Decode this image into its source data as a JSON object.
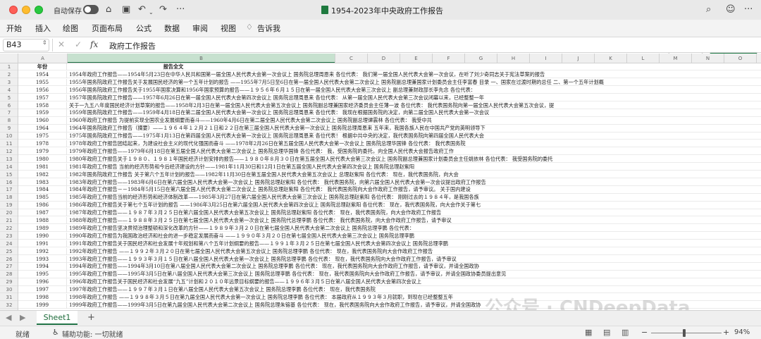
{
  "titlebar": {
    "autosave_label": "自动保存",
    "doc_title": "1954-2023年中央政府工作报告"
  },
  "ribbon": {
    "tabs": [
      "开始",
      "插入",
      "绘图",
      "页面布局",
      "公式",
      "数据",
      "审阅",
      "视图",
      "告诉我"
    ],
    "comment_label": "批注",
    "share_label": "共享"
  },
  "formula_bar": {
    "name_box": "B43",
    "fx_label": "fx",
    "content": "政府工作报告"
  },
  "sheet": {
    "selected_column": "B",
    "column_headers": [
      "A",
      "B",
      "C",
      "D",
      "E",
      "F",
      "G",
      "H",
      "I",
      "J",
      "K",
      "L",
      "M",
      "N",
      "O",
      "P",
      "Q",
      "R",
      "S",
      "T",
      "U"
    ],
    "header_row": {
      "year": "年份",
      "content": "报告全文"
    },
    "rows": [
      {
        "n": "1",
        "a": "年份",
        "b": "报告全文"
      },
      {
        "n": "2",
        "a": "1954",
        "b": "1954年政府工作报告——1954年5月23日在中华人民共和国第一届全国人民代表大会第一次会议上                                    国务院总理周恩来        各位代表：        我们第一届全国人民代表大会第一次会议，在听了刘少奇同志关于宪法草案的报告"
      },
      {
        "n": "3",
        "a": "1955",
        "b": "1955年国务院政府工作报告关于发展国民经济的第一个五年计划的报告 ——1955年7月5日至6日在第一届全国人民代表大会第二次会议上                      国务院副总理兼国家计划委员会主任李富春  目录    一、国家在过渡时期的总任    二、第一个五年计划概"
      },
      {
        "n": "4",
        "a": "1956",
        "b": "1956年国务院政府工作报告关于1955年国家决算和1956年国家预算的报告——１９５６年６月１５日在第一届全国人民代表大会第三次会议上                                              副总理兼财政部长李先念        各位代表："
      },
      {
        "n": "5",
        "a": "1957",
        "b": "1957年国务院政府工作报告——1957年6月26日在第一届全国人民代表大会第四次会议上                          国务院总理周恩来        各位代表：        从第一届全国人民代表大会第三次会议闭幕以来，已经整整一年"
      },
      {
        "n": "6",
        "a": "1958",
        "b": "关于一九五八年度国民经济计划草案的报告——1958年2月3日在第一届全国人民代表大会第五次会议上          国务院副总理兼国家经济委员会主任薄一波        各位代表：        我代表国务院向第一届全国人民代表大会第五次会议，提"
      },
      {
        "n": "7",
        "a": "1959",
        "b": "1959年国务院政府工作报告——1959年4月18日在第二届全国人民代表大会第一次会议上                          国务院总理周恩来        各位代表：        我现在根据国务院的决定，向第二届全国人民代表大会第一次会议"
      },
      {
        "n": "8",
        "a": "1960",
        "b": "     1960年政府工作报告              为提前实现全国农业发展纲要而奋斗——1960年4月6日在第二届全国人民代表大会第二次会议上                                          国务院副总理谭震林        各位代表：        我受中共"
      },
      {
        "n": "9",
        "a": "1964",
        "b": "1964年国务院政府工作报告（摘要）——１９６４年１２月２１日和２２日在第三届全国人民代表大会第一次会议上                                  国务院总理周恩来        五年来，我国各族人民在中国共产党的英明领导下"
      },
      {
        "n": "10",
        "a": "1975",
        "b": "1975年国务院政府工作报告——1975年1月13日在第四届全国人民代表大会第一次会议上                                国务院总理周恩来        各位代表！    根据中共中央的决定，我代表国务院向第四届全国人民代表大会"
      },
      {
        "n": "11",
        "a": "1978",
        "b": "1978年政府工作报告团结起来，为建设社会主义的现代化强国而奋斗    ——1978年2月26日在第五届全国人民代表大会第一次会议上                            国务院总理华国锋        各位代表：        我代表国务院"
      },
      {
        "n": "12",
        "a": "1979",
        "b": "1979年政府工作报告——1979年6月18日在第五届全国人民代表大会第二次会议上                      国务院总理华国锋        各位代表：    我，受国务院的委托，向全国人民代表大会报告政府工作"
      },
      {
        "n": "13",
        "a": "1980",
        "b": "1980年政府工作报告关于１９８０、１９８１年国民经济计划安排的报告——１９８０年８月３０日在第五届全国人民代表大会第三次会议上          国务院副总理兼国家计划委员会主任姚依林        各位代表：    我受国务院的委托"
      },
      {
        "n": "14",
        "a": "1981",
        "b": "1981年政府工作报告      当前的经济形势和今后经济建设的方针——1981年11月30日和12月1日在第五届全国人民代表大会第四次会议上                  国务院总理赵紫阳"
      },
      {
        "n": "15",
        "a": "1982",
        "b": "1982年国务院政府工作报告    关于第六个五年计划的报告——1982年11月30日在第五届全国人民代表大会第五次会议上                    总理赵紫阳        各位代表：    现在，我代表国务院，向大会"
      },
      {
        "n": "16",
        "a": "1983",
        "b": "1983年政府工作报告——1983年6月6日在第六届全国人民代表大会第一次会议上                    国务院总理赵紫阳        各位代表：        我代表国务院，向第六届全国人民代表大会第一次会议提出政府工作报告"
      },
      {
        "n": "17",
        "a": "1984",
        "b": "1984年政府工作报告－－1984年5月15日在第六届全国人民代表大会第二次会议上                  国务院总理赵紫阳        各位代表：        我代表国务院向大会作政府工作报告，请予审议。        关于国内建设"
      },
      {
        "n": "18",
        "a": "1985",
        "b": "1985年政府工作报告当前的经济形势和经济体制改革——1985年3月27日在第六届全国人民代表大会第三次会议上                      国务院总理赵紫阳        各位代表：        刚刚过去的１９８４年，是我国各族"
      },
      {
        "n": "19",
        "a": "1986",
        "b": "     1986年政府工作报告关于第七个五年计划的报告    ——1986年3月25日在第六届全国人民代表大会第四次会议上                      国务院总理赵紫阳        各位代表：        现在，我代表国务院，向大会作关于第七"
      },
      {
        "n": "20",
        "a": "1987",
        "b": "1987年政府工作报告——１９８７年３月２５日在第六届全国人民代表大会第五次会议上                            国务院总理赵紫阳        各位代表：        现在，我代表国务院，向大会作政府工作报告"
      },
      {
        "n": "21",
        "a": "1988",
        "b": "     1988年政府工作报告——１９８８年３月２５日在第七届全国人民代表大会第一次会议上                            国务院代总理李鹏        各位代表：        我代表国务院，向大会作政府工作报告，请予审议"
      },
      {
        "n": "22",
        "a": "1989",
        "b": "1989年政府工作报告坚决贯彻治理整顿和深化改革的方针——１９８９年３月２０日在第七届全国人民代表大会第二次会议上                                    国务院总理李鹏        各位代表："
      },
      {
        "n": "23",
        "a": "1990",
        "b": "     1990年政府工作报告为我国政治经济和社会的进一步稳定发展而奋斗   ——１９９０年３月２０日在第七届全国人民代表大会第三次会议上                                          国务院总理李鹏"
      },
      {
        "n": "24",
        "a": "1991",
        "b": "1991年政府工作报告关于国民经济和社会发展十年规划和第八个五年计划纲要的报告——１９９１年３月２５日在第七届全国人民代表大会第四次会议上                      国务院总理李鹏"
      },
      {
        "n": "25",
        "a": "1992",
        "b": "1992年政府工作报告        ——１９９２年３月２０日在第七届全国人民代表大会第五次会议上                                        国务院总理李鹏        各位代表：        现在，我代表国务院向大会作政府工作报告"
      },
      {
        "n": "26",
        "a": "1993",
        "b": "1993年政府工作报告——１９９３年３月１５日在第八届全国人民代表大会第一次会议上                                   国务院总理李鹏        各位代表：        现在，我代表国务院向大会作政府工作报告，请予审议"
      },
      {
        "n": "27",
        "a": "1994",
        "b": "     1994年政府工作报告——1994年3月10日在第八届全国人民代表大会第二次会议上                              国务院总理李鹏        各位代表：        现在，我代表国务院向大会作政府工作报告，请予审议，并请全国政协"
      },
      {
        "n": "28",
        "a": "1995",
        "b": "1995年政府工作报告——1995年3月5日在第八届全国人民代表大会第三次会议上                          国务院总理李鹏        各位代表：        现在，我代表国务院向大会作政府工作报告，请予审议，并请全国政协委员提出意见"
      },
      {
        "n": "29",
        "a": "1996",
        "b": "     1996年政府工作报告关于国民经济和社会发展“九五”计划和２０１０年远景目标纲要的报告——１９９６年３月５日在第八届全国人民代表大会第四次会议上"
      },
      {
        "n": "30",
        "a": "1997",
        "b": "1997年政府工作报告——１９９７年３月１日在第八届全国人民代表大会第五次会议上                                       国务院总理李鹏        各位代表：        现在，我代表国务院"
      },
      {
        "n": "31",
        "a": "1998",
        "b": "1998年政府工作报告        ——１９９８年３月５日在第九届全国人民代表大会第一次会议上                          国务院总理李鹏        各位代表：        本届政府从１９９３年３月就职，到现在已经整整五年"
      },
      {
        "n": "32",
        "a": "1999",
        "b": "1999年政府工作报告——1999年3月5日在第九届全国人民代表大会第二次会议上                                国务院总理朱镕基        各位代表：        现在，我代表国务院向大会作政府工作报告，请予审议，并请全国政协"
      }
    ]
  },
  "sheet_tabs": {
    "active": "Sheet1",
    "add_label": "+"
  },
  "statusbar": {
    "ready": "就绪",
    "accessibility": "辅助功能: 一切就绪",
    "zoom": "94%",
    "zoom_fraction": 0.94
  },
  "watermark": "公众号 · CNDeepData"
}
